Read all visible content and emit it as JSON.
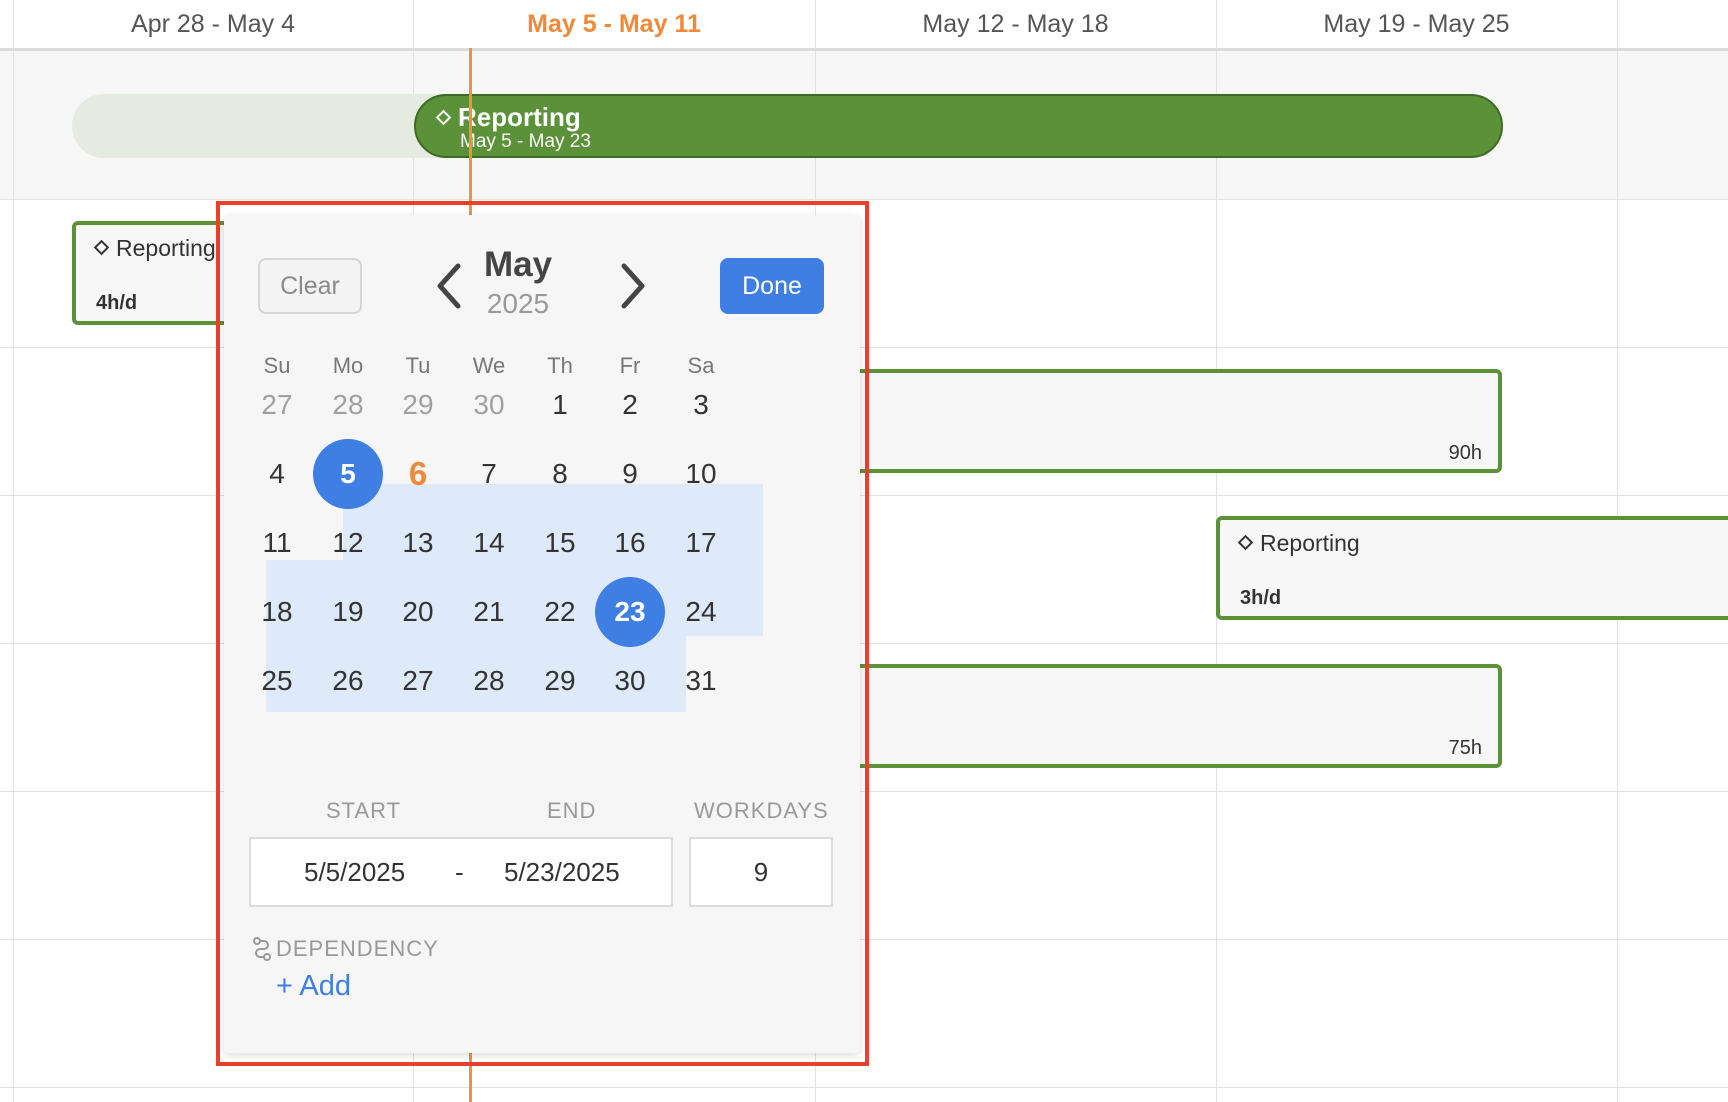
{
  "timeline": {
    "weeks": [
      {
        "label": "Apr 28 - May 4",
        "current": false
      },
      {
        "label": "May 5 - May 11",
        "current": true
      },
      {
        "label": "May 12 - May 18",
        "current": false
      },
      {
        "label": "May 19 - May 25",
        "current": false
      }
    ],
    "phase": {
      "title": "Reporting",
      "dates": "May 5 - May 23"
    },
    "tasks": {
      "task1": {
        "title": "Reporting",
        "meta": "4h/d"
      },
      "task2": {
        "hours": "90h"
      },
      "task3": {
        "title": "Reporting",
        "meta": "3h/d"
      },
      "task4": {
        "hours": "75h"
      }
    },
    "colors": {
      "accent_today": "#f08a3a",
      "bar_green": "#5b9138",
      "select_blue": "#3f7fe3",
      "range_blue": "#deeafa",
      "highlight_border": "#e8402b"
    }
  },
  "picker": {
    "clear_label": "Clear",
    "done_label": "Done",
    "prev_icon": "chevron-left-icon",
    "next_icon": "chevron-right-icon",
    "month": "May",
    "year": "2025",
    "weekdays": [
      "Su",
      "Mo",
      "Tu",
      "We",
      "Th",
      "Fr",
      "Sa"
    ],
    "weeks": [
      [
        {
          "d": "27",
          "muted": true
        },
        {
          "d": "28",
          "muted": true
        },
        {
          "d": "29",
          "muted": true
        },
        {
          "d": "30",
          "muted": true
        },
        {
          "d": "1"
        },
        {
          "d": "2"
        },
        {
          "d": "3"
        }
      ],
      [
        {
          "d": "4"
        },
        {
          "d": "5",
          "selected": true
        },
        {
          "d": "6",
          "today": true
        },
        {
          "d": "7"
        },
        {
          "d": "8"
        },
        {
          "d": "9"
        },
        {
          "d": "10"
        }
      ],
      [
        {
          "d": "11"
        },
        {
          "d": "12"
        },
        {
          "d": "13"
        },
        {
          "d": "14"
        },
        {
          "d": "15"
        },
        {
          "d": "16"
        },
        {
          "d": "17"
        }
      ],
      [
        {
          "d": "18"
        },
        {
          "d": "19"
        },
        {
          "d": "20"
        },
        {
          "d": "21"
        },
        {
          "d": "22"
        },
        {
          "d": "23",
          "selected": true
        },
        {
          "d": "24"
        }
      ],
      [
        {
          "d": "25"
        },
        {
          "d": "26"
        },
        {
          "d": "27"
        },
        {
          "d": "28"
        },
        {
          "d": "29"
        },
        {
          "d": "30"
        },
        {
          "d": "31"
        }
      ]
    ],
    "start_label": "START",
    "end_label": "END",
    "workdays_label": "WORKDAYS",
    "start_value": "5/5/2025",
    "separator": "-",
    "end_value": "5/23/2025",
    "workdays_value": "9",
    "dependency_label": "DEPENDENCY",
    "add_label": "+ Add"
  }
}
